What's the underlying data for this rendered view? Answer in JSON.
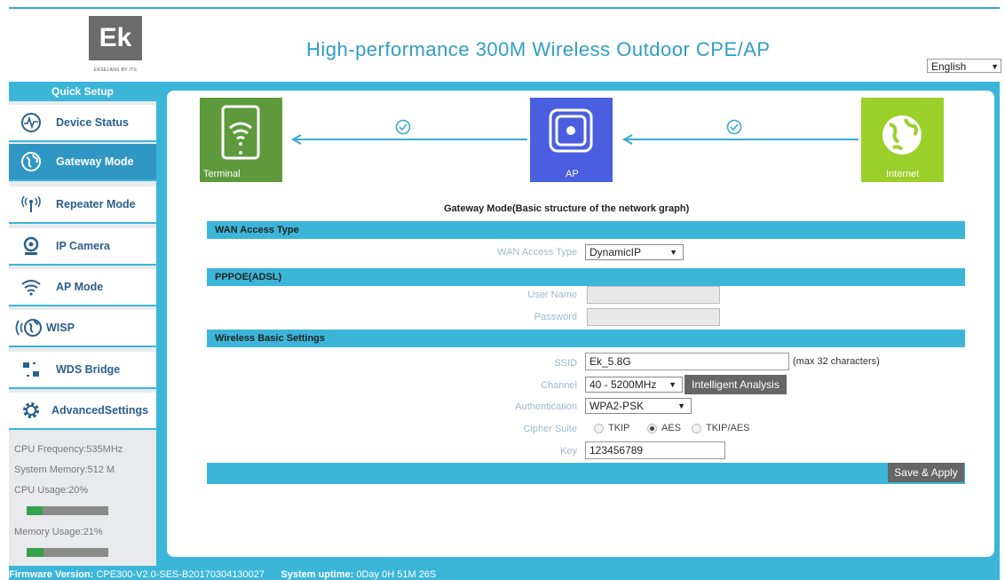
{
  "header": {
    "logo_text": "Ek",
    "logo_subtitle": "EKSELANS BY ITS",
    "title": "High-performance  300M Wireless Outdoor CPE/AP",
    "language": "English"
  },
  "sidebar": {
    "quick_setup": "Quick Setup",
    "items": [
      {
        "label": "Device Status",
        "icon": "pulse-icon"
      },
      {
        "label": "Gateway Mode",
        "icon": "globe-icon"
      },
      {
        "label": "Repeater Mode",
        "icon": "antenna-icon"
      },
      {
        "label": "IP Camera",
        "icon": "camera-icon"
      },
      {
        "label": "AP Mode",
        "icon": "wifi-icon"
      },
      {
        "label": "WISP",
        "icon": "globe-signal-icon"
      },
      {
        "label": "WDS Bridge",
        "icon": "bridge-icon"
      },
      {
        "label": "AdvancedSettings",
        "icon": "gear-icon"
      }
    ],
    "stats": {
      "cpu_frequency": "CPU Frequency:535MHz",
      "system_memory": "System Memory:512 M",
      "cpu_usage": "CPU Usage:20%",
      "cpu_usage_value": 20,
      "memory_usage": "Memory Usage:21%",
      "memory_usage_value": 21
    }
  },
  "diagram": {
    "terminal_label": "Terminal",
    "ap_label": "AP",
    "internet_label": "Internet",
    "terminal_color": "#5e9a3c",
    "ap_color": "#4a5ee0",
    "internet_color": "#9bd02a"
  },
  "main": {
    "caption": "Gateway Mode(Basic structure of the network graph)",
    "wan_section": "WAN Access Type",
    "wan_access_label": "WAN Access Type",
    "wan_access_value": "DynamicIP",
    "pppoe_section": "PPPOE(ADSL)",
    "username_label": "User Name",
    "username_value": "",
    "password_label": "Password",
    "password_value": "",
    "wireless_section": "Wireless Basic Settings",
    "ssid_label": "SSID",
    "ssid_value": "Ek_5.8G",
    "ssid_hint": "(max 32 characters)",
    "channel_label": "Channel",
    "channel_value": "40 - 5200MHz",
    "intelligent_button": "Intelligent Analysis",
    "auth_label": "Authentication",
    "auth_value": "WPA2-PSK",
    "cipher_label": "Cipher Suite",
    "cipher_options": [
      "TKIP",
      "AES",
      "TKIP/AES"
    ],
    "cipher_selected": "AES",
    "key_label": "Key",
    "key_value": "123456789",
    "save_button": "Save & Apply"
  },
  "footer": {
    "firmware_label": "Firmware Version:",
    "firmware_value": "CPE300-V2.0-SES-B20170304130027",
    "uptime_label": "System uptime:",
    "uptime_value": "0Day 0H 51M 26S"
  }
}
